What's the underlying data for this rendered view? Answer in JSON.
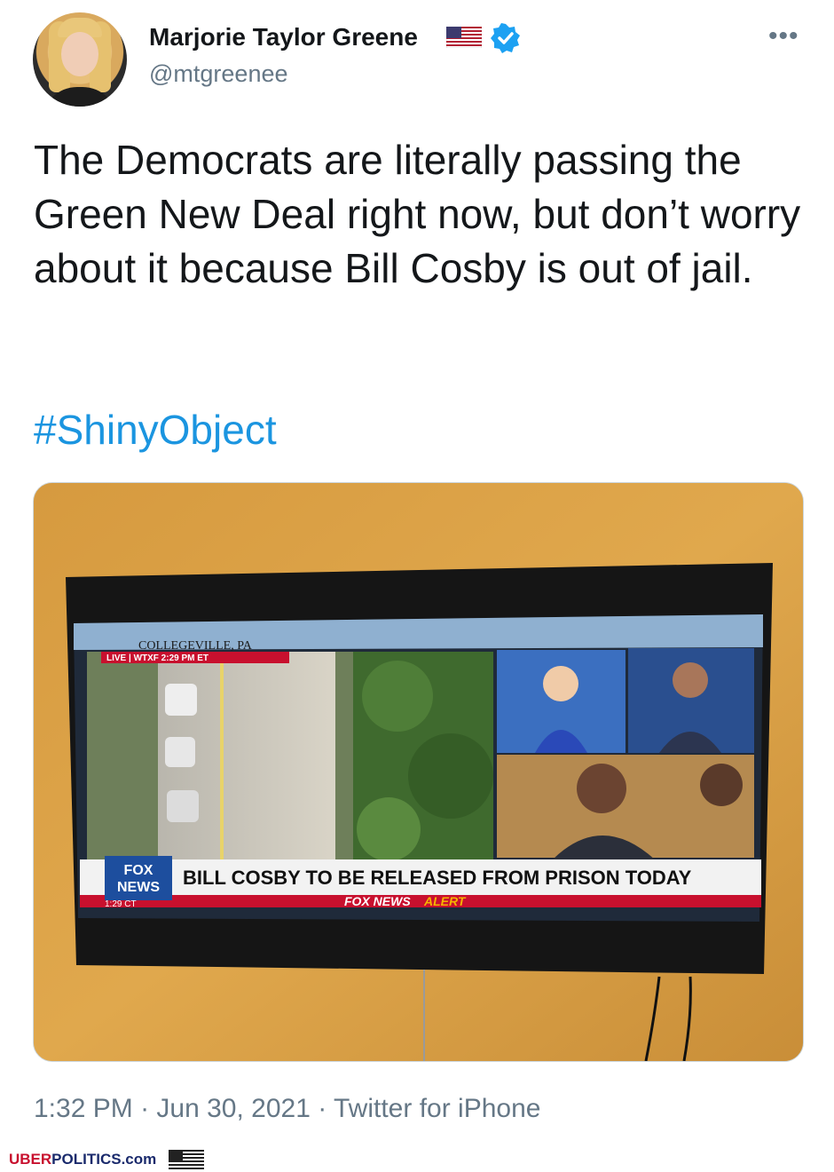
{
  "tweet": {
    "author_name": "Marjorie Taylor Greene",
    "handle": "@mtgreenee",
    "text": "The Democrats are literally passing the Green New Deal right now, but don’t worry about it because Bill Cosby is out of jail.",
    "hashtag": "#ShinyObject",
    "time": "1:32 PM",
    "date": "Jun 30, 2021",
    "source": "Twitter for iPhone",
    "separator": " · "
  },
  "media": {
    "location": "COLLEGEVILLE, PA",
    "live_bar": "LIVE  |  WTXF   2:29 PM ET",
    "network": "FOX",
    "network2": "NEWS",
    "headline": "BILL COSBY TO BE RELEASED FROM PRISON TODAY",
    "alert_a": "FOX NEWS",
    "alert_b": "ALERT",
    "clock": "1:29 CT"
  },
  "watermark": {
    "part1": "UBER",
    "part2": "POLITICS.com"
  },
  "icons": {
    "flag": "us-flag-icon",
    "verified": "verified-badge-icon",
    "more": "more-options-icon"
  },
  "colors": {
    "link": "#1b95e0",
    "verified": "#1da1f2",
    "secondary_text": "#657786",
    "fox_red": "#c8102e"
  }
}
